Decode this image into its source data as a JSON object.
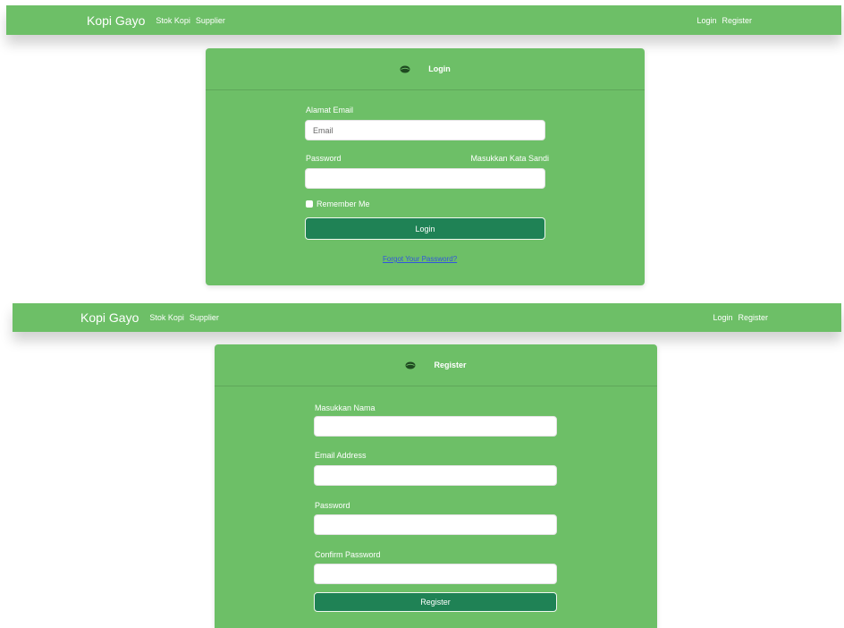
{
  "colors": {
    "green": "#6dbf67",
    "button": "#1f8255",
    "link": "#3355dd"
  },
  "navbar_top": {
    "brand": "Kopi Gayo",
    "links": [
      "Stok Kopi",
      "Supplier"
    ],
    "right_links": [
      "Login",
      "Register"
    ]
  },
  "login_card": {
    "icon": "coffee-bean-icon",
    "title": "Login",
    "email_label": "Alamat Email",
    "email_value": "Email",
    "password_label": "Password",
    "password_hint": "Masukkan Kata Sandi",
    "password_value": "",
    "remember_label": "Remember Me",
    "login_button": "Login",
    "forgot_link": "Forgot Your Password?"
  },
  "navbar_bottom": {
    "brand": "Kopi Gayo",
    "links": [
      "Stok Kopi",
      "Supplier"
    ],
    "right_links": [
      "Login",
      "Register"
    ]
  },
  "register_card": {
    "icon": "coffee-bean-icon",
    "title": "Register",
    "name_label": "Masukkan Nama",
    "email_label": "Email Address",
    "password_label": "Password",
    "confirm_label": "Confirm Password",
    "register_button": "Register"
  }
}
